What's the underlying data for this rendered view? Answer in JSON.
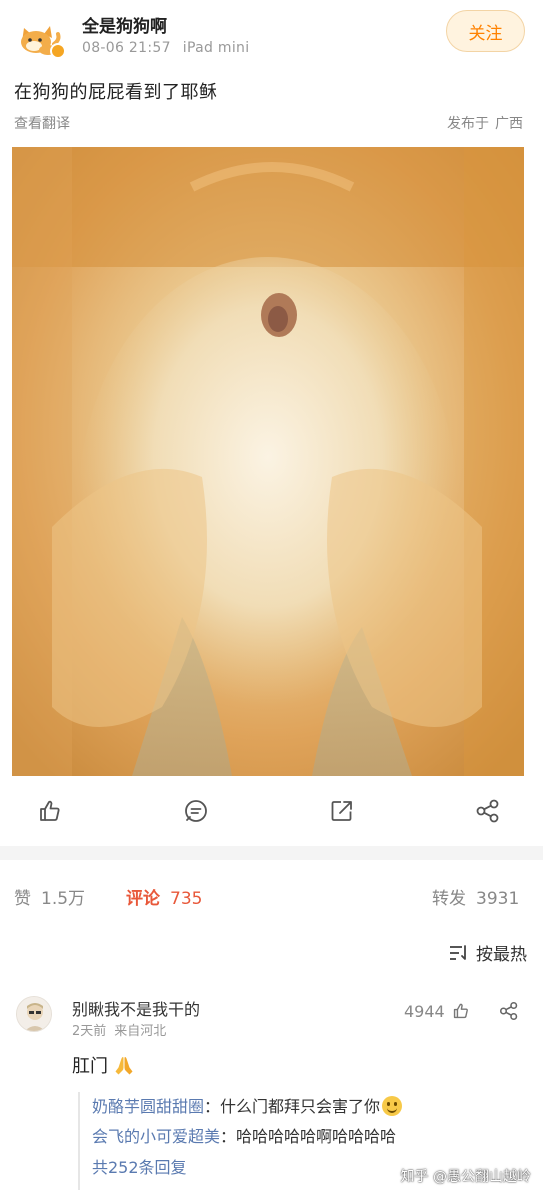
{
  "post": {
    "author": "全是狗狗啊",
    "date": "08-06 21:57",
    "device": "iPad mini",
    "follow_label": "关注",
    "text": "在狗狗的屁屁看到了耶稣",
    "translate_label": "查看翻译",
    "location_prefix": "发布于",
    "location": "广西",
    "image_alt": "狗狗屁屁照片"
  },
  "actions": {
    "like_icon": "thumb-up-icon",
    "comment_icon": "comment-icon",
    "repost_icon": "repost-icon",
    "share_icon": "share-icon"
  },
  "stats": {
    "likes_label": "赞",
    "likes_count": "1.5万",
    "comments_label": "评论",
    "comments_count": "735",
    "reposts_label": "转发",
    "reposts_count": "3931"
  },
  "sort": {
    "label": "按最热"
  },
  "comment": {
    "author": "别瞅我不是我干的",
    "time": "2天前",
    "source": "来自河北",
    "likes": "4944",
    "text": "肛门",
    "replies": [
      {
        "name": "奶酪芋圆甜甜圈",
        "text": "：什么门都拜只会害了你"
      },
      {
        "name": "会飞的小可爱超美",
        "text": "：哈哈哈哈哈啊哈哈哈哈"
      }
    ],
    "total_replies": "共252条回复"
  },
  "watermark": "知乎 @愚公翻山越岭",
  "colors": {
    "accent_orange": "#ff8200",
    "comment_red": "#e8583a",
    "reply_name_blue": "#5a7ab0"
  }
}
